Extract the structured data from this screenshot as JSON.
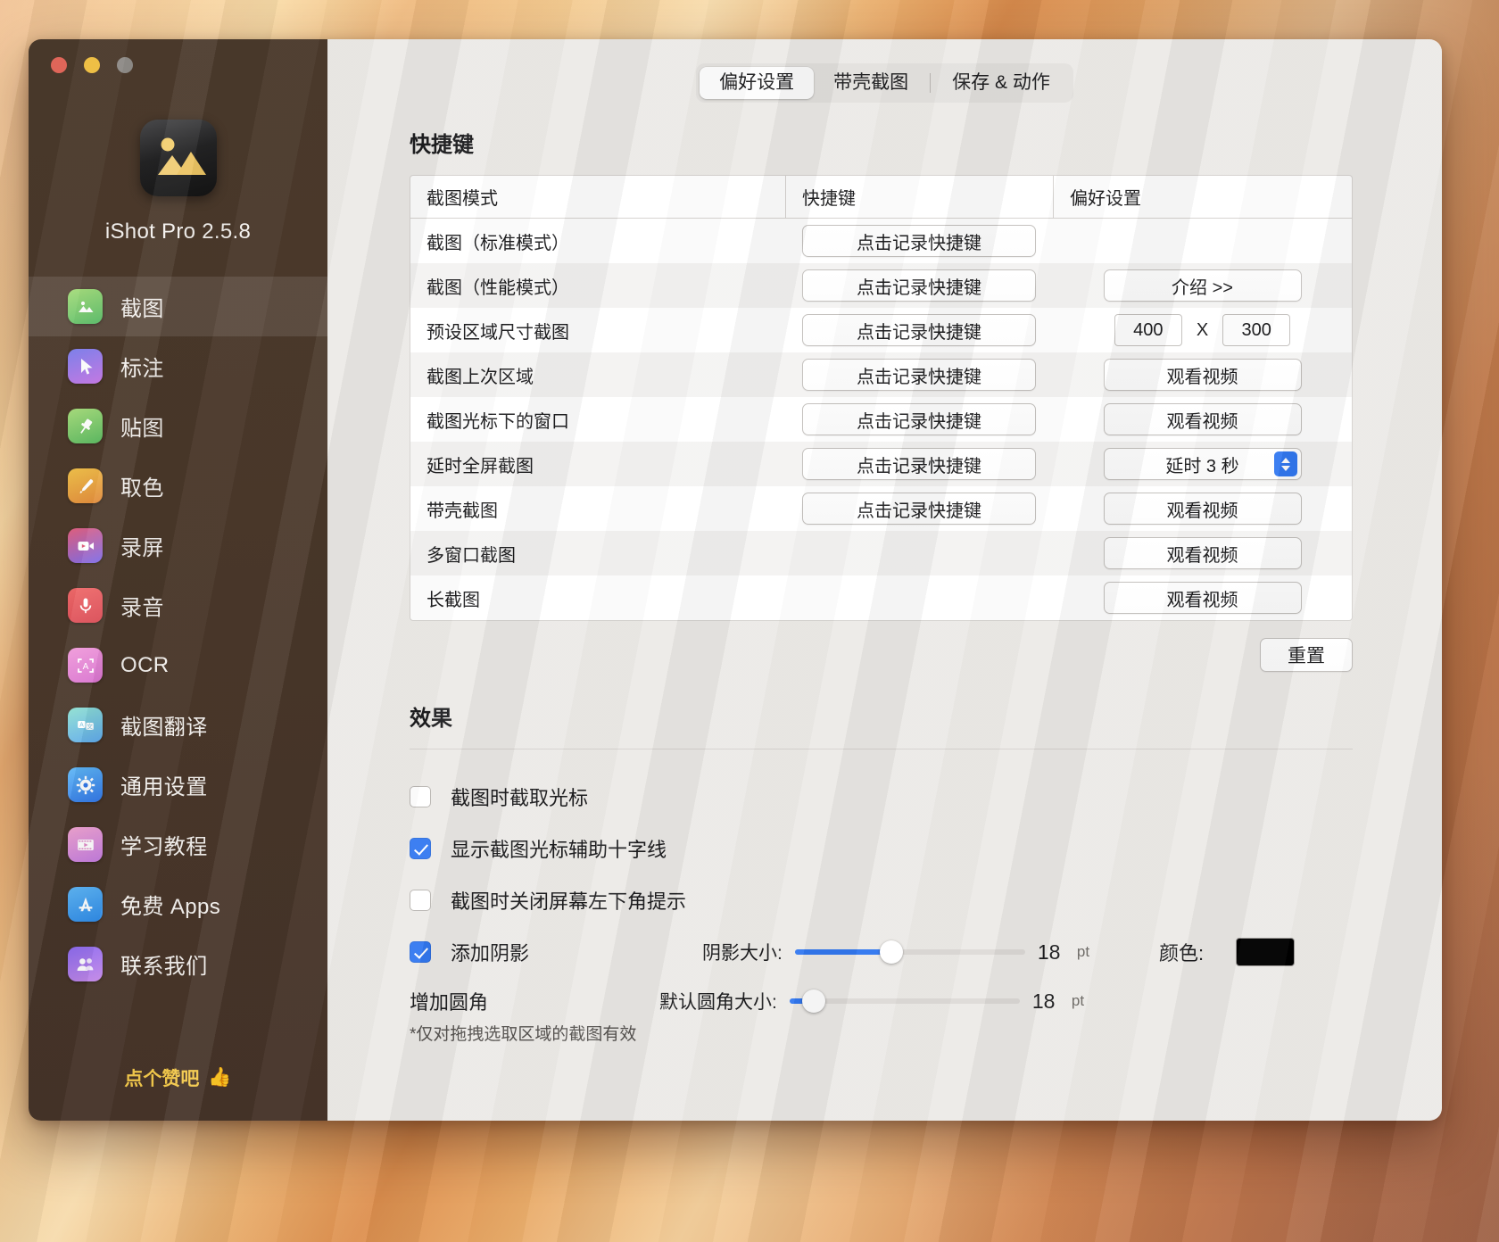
{
  "sidebar": {
    "app_title": "iShot Pro 2.5.8",
    "app_icon": "photo-mountain-icon",
    "traffic_lights": [
      "close",
      "minimize",
      "zoom"
    ],
    "items": [
      {
        "label": "截图",
        "icon": "screenshot-icon",
        "active": true
      },
      {
        "label": "标注",
        "icon": "annotate-icon",
        "active": false
      },
      {
        "label": "贴图",
        "icon": "pin-icon",
        "active": false
      },
      {
        "label": "取色",
        "icon": "eyedropper-icon",
        "active": false
      },
      {
        "label": "录屏",
        "icon": "screenrecord-icon",
        "active": false
      },
      {
        "label": "录音",
        "icon": "microphone-icon",
        "active": false
      },
      {
        "label": "OCR",
        "icon": "ocr-icon",
        "active": false
      },
      {
        "label": "截图翻译",
        "icon": "translate-icon",
        "active": false
      },
      {
        "label": "通用设置",
        "icon": "gear-icon",
        "active": false
      },
      {
        "label": "学习教程",
        "icon": "tutorial-icon",
        "active": false
      },
      {
        "label": "免费 Apps",
        "icon": "appstore-icon",
        "active": false
      },
      {
        "label": "联系我们",
        "icon": "contact-icon",
        "active": false
      }
    ],
    "footer": {
      "text": "点个赞吧",
      "emoji": "👍"
    }
  },
  "tabs": [
    {
      "label": "偏好设置",
      "active": true
    },
    {
      "label": "带壳截图",
      "active": false
    },
    {
      "label": "保存 & 动作",
      "active": false
    }
  ],
  "shortcuts": {
    "title": "快捷键",
    "headers": [
      "截图模式",
      "快捷键",
      "偏好设置"
    ],
    "record_label": "点击记录快捷键",
    "rows": [
      {
        "mode": "截图（标准模式）",
        "record": true,
        "pref_type": "none",
        "pref_label": ""
      },
      {
        "mode": "截图（性能模式）",
        "record": true,
        "pref_type": "button",
        "pref_label": "介绍  >>"
      },
      {
        "mode": "预设区域尺寸截图",
        "record": true,
        "pref_type": "dims",
        "width": "400",
        "x": "X",
        "height": "300"
      },
      {
        "mode": "截图上次区域",
        "record": true,
        "pref_type": "button",
        "pref_label": "观看视频"
      },
      {
        "mode": "截图光标下的窗口",
        "record": true,
        "pref_type": "button",
        "pref_label": "观看视频"
      },
      {
        "mode": "延时全屏截图",
        "record": true,
        "pref_type": "popup",
        "pref_label": "延时 3 秒"
      },
      {
        "mode": "带壳截图",
        "record": true,
        "pref_type": "button",
        "pref_label": "观看视频"
      },
      {
        "mode": "多窗口截图",
        "record": false,
        "pref_type": "button",
        "pref_label": "观看视频"
      },
      {
        "mode": "长截图",
        "record": false,
        "pref_type": "button",
        "pref_label": "观看视频"
      }
    ],
    "reset_label": "重置"
  },
  "effects": {
    "title": "效果",
    "checkboxes": [
      {
        "label": "截图时截取光标",
        "checked": false
      },
      {
        "label": "显示截图光标辅助十字线",
        "checked": true
      },
      {
        "label": "截图时关闭屏幕左下角提示",
        "checked": false
      }
    ],
    "shadow": {
      "label": "添加阴影",
      "checked": true,
      "slider_label": "阴影大小:",
      "value": "18",
      "unit": "pt",
      "fill_percent": 42,
      "color_label": "颜色:",
      "color_value": "#000000"
    },
    "corner": {
      "label": "增加圆角",
      "slider_label": "默认圆角大小:",
      "value": "18",
      "unit": "pt",
      "fill_percent": 8,
      "note": "*仅对拖拽选取区域的截图有效"
    }
  },
  "colors": {
    "accent": "#3278f0",
    "sidebar_bg": "#4a382a",
    "content_bg": "#eceae7",
    "footer_gold": "#f2c84b"
  }
}
